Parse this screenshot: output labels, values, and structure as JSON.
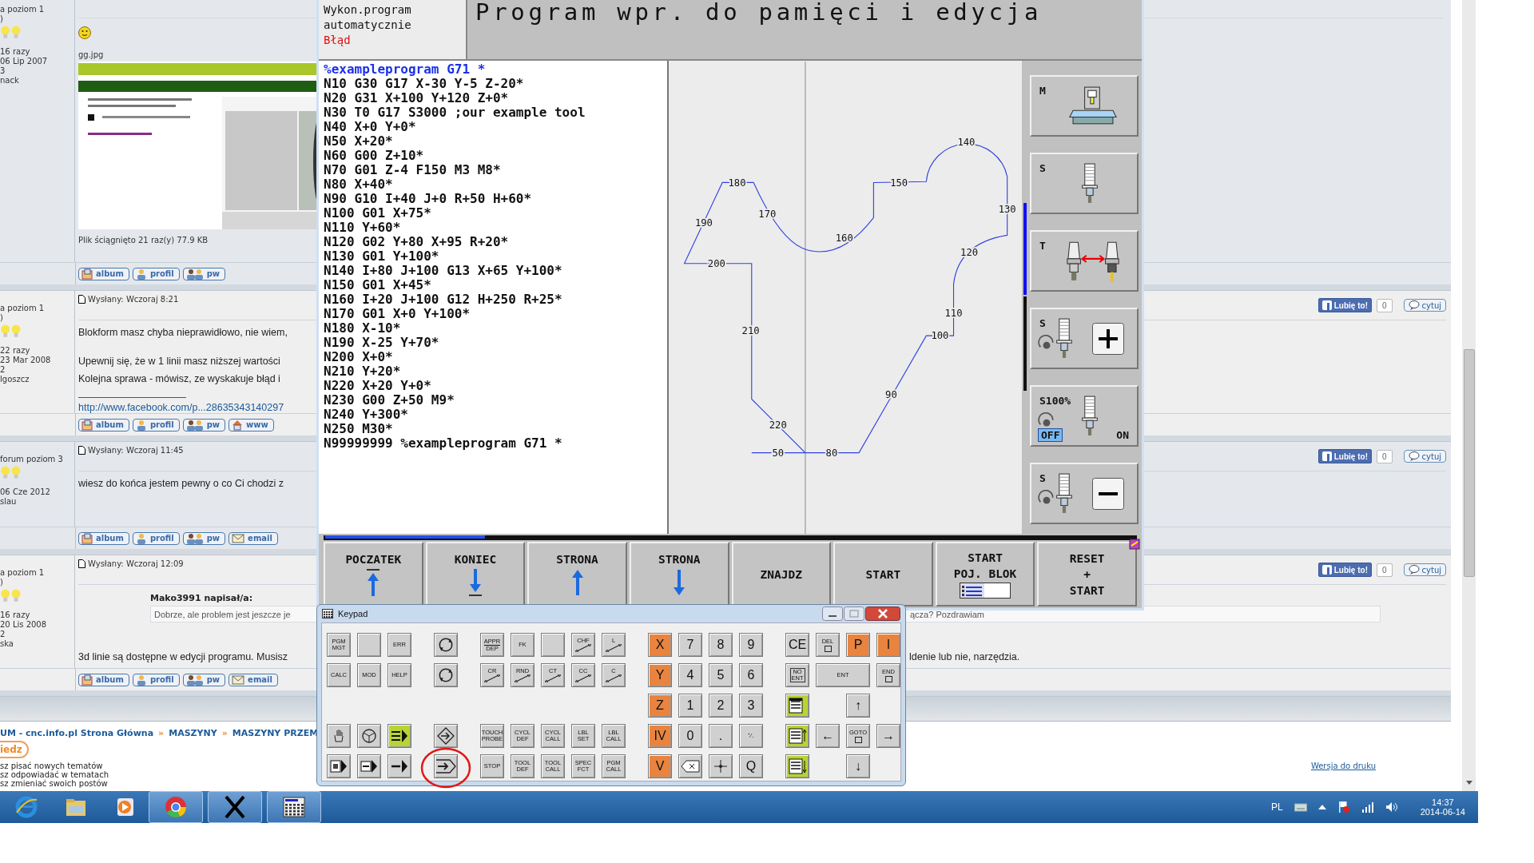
{
  "forum": {
    "posts": [
      {
        "rank": [
          "a poziom 1",
          ")"
        ],
        "info": [
          "16 razy",
          "06 Lip 2007",
          "3",
          "nack"
        ],
        "blocks": [
          {
            "kind": "smiley"
          },
          {
            "kind": "text",
            "text": "gg.jpg"
          },
          {
            "kind": "picture"
          },
          {
            "kind": "text",
            "text": "Plik ściągnięto 21 raz(y) 77.9 KB"
          }
        ],
        "buttons": [
          {
            "label": "album",
            "kind": "album"
          },
          {
            "label": "profil",
            "kind": "profile"
          },
          {
            "label": "pw",
            "kind": "message"
          }
        ]
      },
      {
        "posted": "Wysłany: Wczoraj 8:21",
        "like": {
          "label": "Lubię to!",
          "count": "0",
          "quote": "cytuj"
        },
        "rank": [
          "a poziom 1",
          ")"
        ],
        "info": [
          "22 razy",
          "23 Mar 2008",
          "2",
          "lgoszcz"
        ],
        "blocks": [
          {
            "kind": "text",
            "text": "Blokform masz chyba nieprawidłowo, nie wiem,"
          },
          {
            "kind": "gap"
          },
          {
            "kind": "text",
            "text": "Upewnij się, że w 1 linii masz niższej wartości"
          },
          {
            "kind": "text",
            "text": "Kolejna sprawa - mówisz, ze wyskakuje błąd i"
          },
          {
            "kind": "rule"
          },
          {
            "kind": "link",
            "text": "http://www.facebook.com/p...28635343140297"
          }
        ],
        "buttons": [
          {
            "label": "album",
            "kind": "album"
          },
          {
            "label": "profil",
            "kind": "profile"
          },
          {
            "label": "pw",
            "kind": "message"
          },
          {
            "label": "www",
            "kind": "www"
          }
        ]
      },
      {
        "posted": "Wysłany: Wczoraj 11:45",
        "like": {
          "label": "Lubię to!",
          "count": "0",
          "quote": "cytuj"
        },
        "rank": [
          "forum poziom 3"
        ],
        "info": [
          "06 Cze 2012",
          "slau"
        ],
        "blocks": [
          {
            "kind": "text",
            "text": "wiesz do końca jestem pewny o co Ci chodzi z"
          }
        ],
        "buttons": [
          {
            "label": "album",
            "kind": "album"
          },
          {
            "label": "profil",
            "kind": "profile"
          },
          {
            "label": "pw",
            "kind": "message"
          },
          {
            "label": "email",
            "kind": "email"
          }
        ]
      },
      {
        "posted": "Wysłany: Wczoraj 12:09",
        "like": {
          "label": "Lubię to!",
          "count": "0",
          "quote": "cytuj"
        },
        "rank": [
          "a poziom 1",
          ")"
        ],
        "info": [
          "16 razy",
          "20 Lis 2008",
          "2",
          "ska"
        ],
        "blocks": [
          {
            "kind": "quote",
            "author": "Mako3991 napisał/a:",
            "text": "Dobrze, ale problem jest jeszcze je",
            "text_right": "ącza? Pozdrawiam"
          },
          {
            "kind": "text",
            "text": "3d linie są dostępne w edycji programu. Musisz",
            "text_right": "ldenie lub nie, narzędzia."
          }
        ],
        "buttons": [
          {
            "label": "album",
            "kind": "album"
          },
          {
            "label": "profil",
            "kind": "profile"
          },
          {
            "label": "pw",
            "kind": "message"
          },
          {
            "label": "email",
            "kind": "email"
          }
        ]
      }
    ],
    "breadcrumb": [
      {
        "text": "UM - cnc.info.pl Strona Główna",
        "kind": "link"
      },
      {
        "text": "»",
        "kind": "separator"
      },
      {
        "text": "MASZYNY",
        "kind": "link"
      },
      {
        "text": "»",
        "kind": "separator"
      },
      {
        "text": "MASZYNY PRZEM",
        "kind": "link"
      }
    ],
    "reply_button": "iedz",
    "permissions": [
      "sz pisać nowych tematów",
      "sz odpowiadać w tematach",
      "sz zmieniać swoich postów"
    ],
    "print_link": "Wersja do druku"
  },
  "cnc": {
    "mode": [
      "Wykon.program",
      "automatycznie"
    ],
    "error": "Błąd",
    "title": "Program wpr. do pamięci i edycja",
    "listing": [
      {
        "text": "%exampleprogram G71 *",
        "kind": "title"
      },
      {
        "text": "N10 G30 G17 X-30 Y-5 Z-20*",
        "kind": "block"
      },
      {
        "text": "N20 G31 X+100 Y+120 Z+0*",
        "kind": "block"
      },
      {
        "text": "N30 T0 G17 S3000 ;our example tool",
        "kind": "block"
      },
      {
        "text": "N40 X+0 Y+0*",
        "kind": "block"
      },
      {
        "text": "N50 X+20*",
        "kind": "block"
      },
      {
        "text": "N60 G00 Z+10*",
        "kind": "block"
      },
      {
        "text": "N70 G01 Z-4 F150 M3 M8*",
        "kind": "block"
      },
      {
        "text": "N80 X+40*",
        "kind": "block"
      },
      {
        "text": "N90 G10 I+40 J+0 R+50 H+60*",
        "kind": "block"
      },
      {
        "text": "N100 G01 X+75*",
        "kind": "block"
      },
      {
        "text": "N110 Y+60*",
        "kind": "block"
      },
      {
        "text": "N120 G02 Y+80 X+95 R+20*",
        "kind": "block"
      },
      {
        "text": "N130 G01 Y+100*",
        "kind": "block"
      },
      {
        "text": "N140 I+80 J+100 G13 X+65 Y+100*",
        "kind": "block"
      },
      {
        "text": "N150 G01 X+45*",
        "kind": "block"
      },
      {
        "text": "N160 I+20 J+100 G12 H+250 R+25*",
        "kind": "block"
      },
      {
        "text": "N170 G01 X+0 Y+100*",
        "kind": "block"
      },
      {
        "text": "N180 X-10*",
        "kind": "block"
      },
      {
        "text": "N190 X-25 Y+70*",
        "kind": "block"
      },
      {
        "text": "N200 X+0*",
        "kind": "block"
      },
      {
        "text": "N210 Y+20*",
        "kind": "block"
      },
      {
        "text": "N220 X+20 Y+0*",
        "kind": "block"
      },
      {
        "text": "N230 G00 Z+50 M9*",
        "kind": "block"
      },
      {
        "text": "N240 Y+300*",
        "kind": "block"
      },
      {
        "text": "N250 M30*",
        "kind": "block"
      },
      {
        "text": "N99999999 %exampleprogram G71 *",
        "kind": "block"
      }
    ],
    "contour_labels": [
      "180",
      "170",
      "190",
      "200",
      "210",
      "220",
      "50",
      "80",
      "90",
      "100",
      "110",
      "120",
      "130",
      "140",
      "150",
      "160"
    ],
    "side_buttons": [
      {
        "label": "M",
        "kind": "machine"
      },
      {
        "label": "S",
        "kind": "spindle"
      },
      {
        "label": "T",
        "kind": "tool-change"
      },
      {
        "label": "S",
        "kind": "spindle-plus"
      },
      {
        "label": "S100%",
        "kind": "override",
        "options": [
          {
            "label": "OFF",
            "selected": true
          },
          {
            "label": "ON",
            "selected": false
          }
        ]
      },
      {
        "label": "S",
        "kind": "spindle-minus"
      }
    ],
    "softkeys": [
      {
        "lines": [
          "POCZATEK"
        ],
        "kind": "arrow-up-bar"
      },
      {
        "lines": [
          "KONIEC"
        ],
        "kind": "arrow-down-bar"
      },
      {
        "lines": [
          "STRONA"
        ],
        "kind": "arrow-up"
      },
      {
        "lines": [
          "STRONA"
        ],
        "kind": "arrow-down"
      },
      {
        "lines": [
          "ZNAJDZ"
        ],
        "kind": "plain"
      },
      {
        "lines": [
          "START"
        ],
        "kind": "plain"
      },
      {
        "lines": [
          "START",
          "POJ. BLOK"
        ],
        "kind": "single-block"
      },
      {
        "lines": [
          "RESET",
          "+",
          "START"
        ],
        "kind": "plain"
      }
    ]
  },
  "keypad": {
    "title": "Keypad",
    "groups": [
      {
        "rows": [
          [
            {
              "kind": "text",
              "lines": [
                "PGM",
                "MGT"
              ],
              "color": "#d0d0d0"
            },
            {
              "kind": "blank",
              "color": "#d0d0d0"
            },
            {
              "kind": "text",
              "lines": [
                "ERR"
              ],
              "color": "#d0d0d0"
            }
          ],
          [
            {
              "kind": "text",
              "lines": [
                "CALC"
              ],
              "color": "#d0d0d0"
            },
            {
              "kind": "text",
              "lines": [
                "MOD"
              ],
              "color": "#d0d0d0"
            },
            {
              "kind": "text",
              "lines": [
                "HELP"
              ],
              "color": "#d0d0d0"
            }
          ],
          [
            null,
            null,
            null
          ],
          [
            {
              "kind": "hand",
              "color": "#d0d0d0"
            },
            {
              "kind": "wheel",
              "color": "#d0d0d0"
            },
            {
              "kind": "list-run",
              "color": "#b6d433"
            }
          ],
          [
            {
              "kind": "page-run",
              "color": "#d0d0d0"
            },
            {
              "kind": "step-run",
              "color": "#d0d0d0"
            },
            {
              "kind": "arrow-run",
              "color": "#d0d0d0"
            }
          ]
        ]
      },
      {
        "rows": [
          [
            {
              "kind": "circle-arrows",
              "color": "#d0d0d0"
            }
          ],
          [
            {
              "kind": "circle-arrows",
              "color": "#d0d0d0"
            }
          ],
          [
            null
          ],
          [
            {
              "kind": "arrow-diamond",
              "color": "#d0d0d0"
            }
          ],
          [
            {
              "kind": "arrow-pentagon",
              "color": "#d0d0d0"
            }
          ]
        ]
      },
      {
        "rows": [
          [
            {
              "kind": "fraction",
              "lines": [
                "APPR",
                "DEP"
              ],
              "color": "#d0d0d0"
            },
            {
              "kind": "text",
              "lines": [
                "FK"
              ],
              "color": "#d0d0d0"
            },
            {
              "kind": "blank",
              "color": "#d0d0d0"
            },
            {
              "kind": "contour",
              "lines": [
                "CHF"
              ],
              "color": "#d0d0d0"
            },
            {
              "kind": "contour",
              "lines": [
                "L"
              ],
              "color": "#d0d0d0"
            }
          ],
          [
            {
              "kind": "contour",
              "lines": [
                "CR"
              ],
              "color": "#d0d0d0"
            },
            {
              "kind": "contour",
              "lines": [
                "RND"
              ],
              "color": "#d0d0d0"
            },
            {
              "kind": "contour",
              "lines": [
                "CT"
              ],
              "color": "#d0d0d0"
            },
            {
              "kind": "contour",
              "lines": [
                "CC"
              ],
              "color": "#d0d0d0"
            },
            {
              "kind": "contour",
              "lines": [
                "C"
              ],
              "color": "#d0d0d0"
            }
          ],
          [
            null,
            null,
            null,
            null,
            null
          ],
          [
            {
              "kind": "text",
              "lines": [
                "TOUCH",
                "PROBE"
              ],
              "color": "#d0d0d0"
            },
            {
              "kind": "text",
              "lines": [
                "CYCL",
                "DEF"
              ],
              "color": "#d0d0d0"
            },
            {
              "kind": "text",
              "lines": [
                "CYCL",
                "CALL"
              ],
              "color": "#d0d0d0"
            },
            {
              "kind": "text",
              "lines": [
                "LBL",
                "SET"
              ],
              "color": "#d0d0d0"
            },
            {
              "kind": "text",
              "lines": [
                "LBL",
                "CALL"
              ],
              "color": "#d0d0d0"
            }
          ],
          [
            {
              "kind": "text",
              "lines": [
                "STOP"
              ],
              "color": "#d0d0d0"
            },
            {
              "kind": "text",
              "lines": [
                "TOOL",
                "DEF"
              ],
              "color": "#d0d0d0"
            },
            {
              "kind": "text",
              "lines": [
                "TOOL",
                "CALL"
              ],
              "color": "#d0d0d0"
            },
            {
              "kind": "text",
              "lines": [
                "SPEC",
                "FCT"
              ],
              "color": "#d0d0d0"
            },
            {
              "kind": "text",
              "lines": [
                "PGM",
                "CALL"
              ],
              "color": "#d0d0d0"
            }
          ]
        ]
      },
      {
        "rows": [
          [
            {
              "kind": "big",
              "lines": [
                "X"
              ],
              "color": "#e8843f"
            },
            {
              "kind": "big",
              "lines": [
                "7"
              ],
              "color": "#d0d0d0"
            },
            {
              "kind": "big",
              "lines": [
                "8"
              ],
              "color": "#d0d0d0"
            },
            {
              "kind": "big",
              "lines": [
                "9"
              ],
              "color": "#d0d0d0"
            }
          ],
          [
            {
              "kind": "big",
              "lines": [
                "Y"
              ],
              "color": "#e8843f"
            },
            {
              "kind": "big",
              "lines": [
                "4"
              ],
              "color": "#d0d0d0"
            },
            {
              "kind": "big",
              "lines": [
                "5"
              ],
              "color": "#d0d0d0"
            },
            {
              "kind": "big",
              "lines": [
                "6"
              ],
              "color": "#d0d0d0"
            }
          ],
          [
            {
              "kind": "big",
              "lines": [
                "Z"
              ],
              "color": "#e8843f"
            },
            {
              "kind": "big",
              "lines": [
                "1"
              ],
              "color": "#d0d0d0"
            },
            {
              "kind": "big",
              "lines": [
                "2"
              ],
              "color": "#d0d0d0"
            },
            {
              "kind": "big",
              "lines": [
                "3"
              ],
              "color": "#d0d0d0"
            }
          ],
          [
            {
              "kind": "big",
              "lines": [
                "IV"
              ],
              "color": "#e8843f"
            },
            {
              "kind": "big",
              "lines": [
                "0"
              ],
              "color": "#d0d0d0"
            },
            {
              "kind": "big",
              "lines": [
                "."
              ],
              "color": "#d0d0d0"
            },
            {
              "kind": "big",
              "lines": [
                "⁺⁄₋"
              ],
              "color": "#d0d0d0"
            }
          ],
          [
            {
              "kind": "big",
              "lines": [
                "V"
              ],
              "color": "#e8843f"
            },
            {
              "kind": "backspace",
              "color": "#d0d0d0"
            },
            {
              "kind": "crosshair",
              "color": "#d0d0d0"
            },
            {
              "kind": "big",
              "lines": [
                "Q"
              ],
              "color": "#d0d0d0"
            }
          ]
        ]
      },
      {
        "rows": [
          [
            {
              "kind": "big",
              "lines": [
                "CE"
              ],
              "color": "#d0d0d0"
            },
            {
              "kind": "boxed",
              "lines": [
                "DEL"
              ],
              "color": "#d0d0d0"
            },
            {
              "kind": "big",
              "lines": [
                "P"
              ],
              "color": "#e8843f"
            },
            {
              "kind": "big",
              "lines": [
                "I"
              ],
              "color": "#e8843f"
            }
          ],
          [
            {
              "kind": "framed",
              "lines": [
                "NO",
                "ENT"
              ],
              "color": "#d0d0d0"
            },
            {
              "kind": "text",
              "lines": [
                "ENT"
              ],
              "color": "#d0d0d0",
              "colspan": 2
            },
            {
              "kind": "boxed",
              "lines": [
                "END"
              ],
              "color": "#d0d0d0"
            }
          ],
          [
            {
              "kind": "page",
              "color": "#b6d433"
            },
            null,
            {
              "kind": "big",
              "lines": [
                "↑"
              ],
              "color": "#d0d0d0"
            },
            null
          ],
          [
            {
              "kind": "pages-up",
              "color": "#b6d433"
            },
            {
              "kind": "big",
              "lines": [
                "←"
              ],
              "color": "#d0d0d0"
            },
            {
              "kind": "boxed",
              "lines": [
                "GOTO"
              ],
              "color": "#d0d0d0"
            },
            {
              "kind": "big",
              "lines": [
                "→"
              ],
              "color": "#d0d0d0"
            }
          ],
          [
            {
              "kind": "pages-down",
              "color": "#b6d433"
            },
            null,
            {
              "kind": "big",
              "lines": [
                "↓"
              ],
              "color": "#d0d0d0"
            },
            null
          ]
        ]
      }
    ]
  },
  "taskbar": {
    "language": "PL",
    "time": "14:37",
    "date": "2014-06-14"
  }
}
